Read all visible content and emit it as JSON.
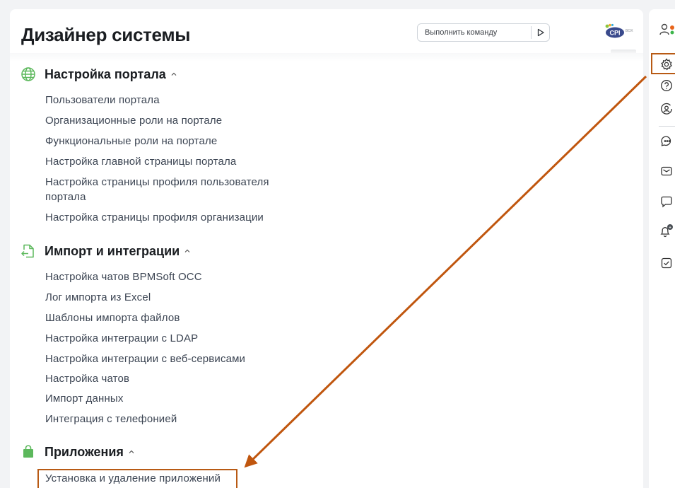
{
  "header": {
    "title": "Дизайнер системы",
    "command_placeholder": "Выполнить команду",
    "logo_text": "CPI",
    "logo_suffix": "BOX"
  },
  "sections": [
    {
      "title": "Настройка портала",
      "icon": "globe-icon",
      "expanded": true,
      "items": [
        {
          "label": "Пользователи портала"
        },
        {
          "label": "Организационные роли на портале"
        },
        {
          "label": "Функциональные роли на портале"
        },
        {
          "label": "Настройка главной страницы портала"
        },
        {
          "label": "Настройка страницы профиля пользователя портала"
        },
        {
          "label": "Настройка страницы профиля организации"
        }
      ]
    },
    {
      "title": "Импорт и интеграции",
      "icon": "file-import-icon",
      "expanded": true,
      "items": [
        {
          "label": "Настройка чатов BPMSoft OCC"
        },
        {
          "label": "Лог импорта из Excel"
        },
        {
          "label": "Шаблоны импорта файлов"
        },
        {
          "label": "Настройка интеграции с LDAP"
        },
        {
          "label": "Настройка интеграции с веб-сервисами"
        },
        {
          "label": "Настройка чатов"
        },
        {
          "label": "Импорт данных"
        },
        {
          "label": "Интеграция с телефонией"
        }
      ]
    },
    {
      "title": "Приложения",
      "icon": "shopping-bag-icon",
      "expanded": true,
      "items": [
        {
          "label": "Установка и удаление приложений",
          "highlighted": true
        }
      ]
    }
  ],
  "right_rail": {
    "icons": [
      "user-icon",
      "gear-icon",
      "help-icon",
      "user-at-icon",
      "chat-bubbles-icon",
      "mail-icon",
      "message-icon",
      "bell-icon",
      "checkbox-task-icon"
    ],
    "highlighted_icon": "gear-icon"
  },
  "colors": {
    "accent_green": "#5cb85c",
    "highlight": "#b85a14",
    "arrow": "#c0560e",
    "link": "#3b4452",
    "badge_green": "#3cb54a",
    "badge_orange": "#e8641a"
  }
}
